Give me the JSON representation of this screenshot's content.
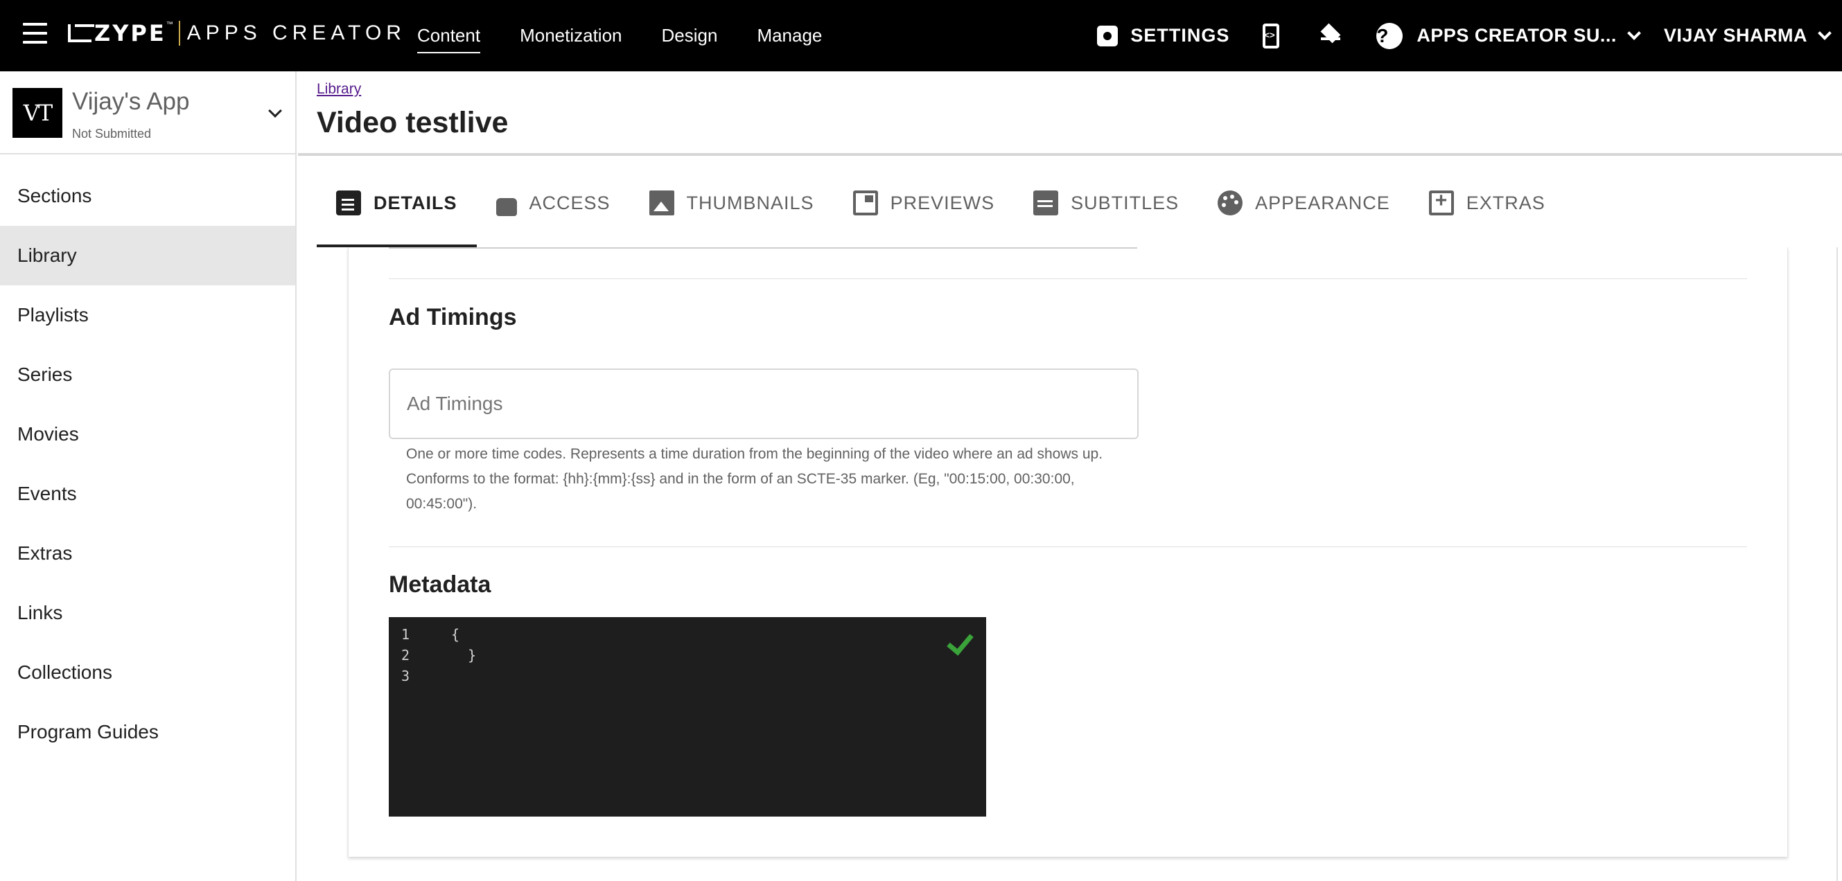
{
  "topbar": {
    "logo_brand": "ZYPE",
    "logo_tm": "™",
    "logo_product": "APPS CREATOR",
    "nav": [
      {
        "label": "Content",
        "active": true
      },
      {
        "label": "Monetization",
        "active": false
      },
      {
        "label": "Design",
        "active": false
      },
      {
        "label": "Manage",
        "active": false
      }
    ],
    "settings_label": "SETTINGS",
    "account_label": "APPS CREATOR SU...",
    "user_label": "VIJAY SHARMA",
    "help_glyph": "?"
  },
  "sidebar": {
    "app_logo_text": "VT",
    "app_name": "Vijay's App",
    "app_status": "Not Submitted",
    "items": [
      {
        "label": "Sections",
        "active": false
      },
      {
        "label": "Library",
        "active": true
      },
      {
        "label": "Playlists",
        "active": false
      },
      {
        "label": "Series",
        "active": false
      },
      {
        "label": "Movies",
        "active": false
      },
      {
        "label": "Events",
        "active": false
      },
      {
        "label": "Extras",
        "active": false
      },
      {
        "label": "Links",
        "active": false
      },
      {
        "label": "Collections",
        "active": false
      },
      {
        "label": "Program Guides",
        "active": false
      }
    ]
  },
  "page": {
    "breadcrumb": "Library",
    "title": "Video testlive"
  },
  "tabs": [
    {
      "label": "DETAILS",
      "icon": "document-icon",
      "active": true
    },
    {
      "label": "ACCESS",
      "icon": "lock-icon",
      "active": false
    },
    {
      "label": "THUMBNAILS",
      "icon": "image-icon",
      "active": false
    },
    {
      "label": "PREVIEWS",
      "icon": "preview-icon",
      "active": false
    },
    {
      "label": "SUBTITLES",
      "icon": "subtitles-icon",
      "active": false
    },
    {
      "label": "APPEARANCE",
      "icon": "palette-icon",
      "active": false
    },
    {
      "label": "EXTRAS",
      "icon": "add-box-icon",
      "active": false
    }
  ],
  "ad_timings": {
    "heading": "Ad Timings",
    "placeholder": "Ad Timings",
    "value": "",
    "helper": "One or more time codes. Represents a time duration from the beginning of the video where an ad shows up. Conforms to the format: {hh}:{mm}:{ss} and in the form of an SCTE-35 marker. (Eg, \"00:15:00, 00:30:00, 00:45:00\")."
  },
  "metadata": {
    "heading": "Metadata",
    "lines": [
      {
        "num": "1",
        "code": "{"
      },
      {
        "num": "2",
        "code": "  }"
      },
      {
        "num": "3",
        "code": ""
      }
    ],
    "valid": true
  },
  "colors": {
    "topbar_bg": "#000000",
    "active_sidebar_bg": "#e6e6e6",
    "editor_bg": "#1e1e1e",
    "valid_check": "#3aa33a",
    "logo_divider": "#c9a94a"
  }
}
